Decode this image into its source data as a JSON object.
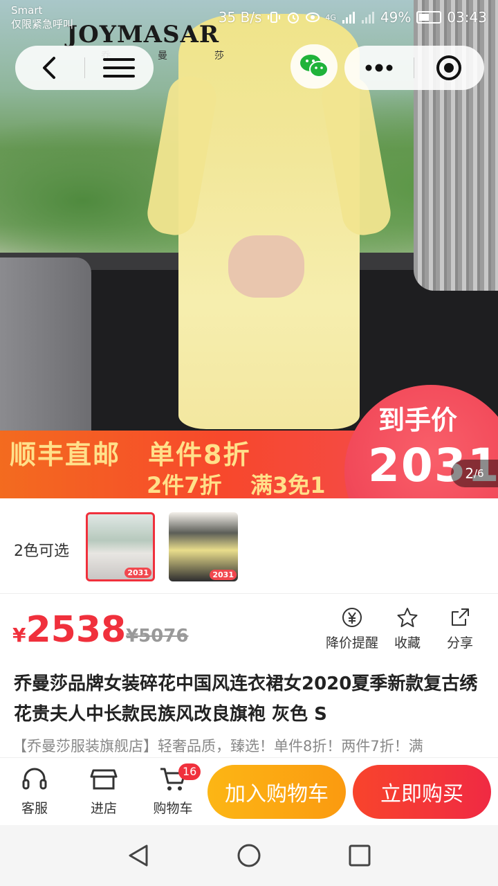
{
  "status_bar": {
    "carrier": "Smart",
    "emergency": "仅限紧急呼叫",
    "speed": "35 B/s",
    "network": "4G",
    "battery": "49%",
    "time": "03:43"
  },
  "hero": {
    "brand": "JOYMASAR",
    "brand_sub": "乔曼莎",
    "promo": {
      "line1a": "顺丰直邮",
      "line1b": "单件8折",
      "line2a": "2件7折",
      "line2b": "满3免1",
      "price_label": "到手价",
      "price_value": "2031"
    },
    "page_indicator": {
      "current": "2",
      "total": "/6"
    }
  },
  "colors": {
    "label": "2色可选",
    "swatches": [
      {
        "name": "灰色",
        "selected": true,
        "tag": "2031"
      },
      {
        "name": "黄色",
        "selected": false,
        "tag": "2031"
      }
    ]
  },
  "price": {
    "currency": "¥",
    "current": "2538",
    "original": "¥5076"
  },
  "actions": [
    {
      "label": "降价提醒",
      "icon": "yen-circle-icon"
    },
    {
      "label": "收藏",
      "icon": "star-icon"
    },
    {
      "label": "分享",
      "icon": "share-icon"
    }
  ],
  "product": {
    "title": "乔曼莎品牌女装碎花中国风连衣裙女2020夏季新款复古绣花贵夫人中长款民族风改良旗袍 灰色 S",
    "desc": "【乔曼莎服装旗舰店】轻奢品质，臻选！单件8折！两件7折！满"
  },
  "bottom_bar": {
    "service": "客服",
    "store": "进店",
    "cart": "购物车",
    "cart_count": "16",
    "add_to_cart": "加入购物车",
    "buy_now": "立即购买"
  },
  "theme": {
    "accent": "#f0303c",
    "cart_button": "#fb9a10",
    "buy_button": "#f02a43"
  }
}
